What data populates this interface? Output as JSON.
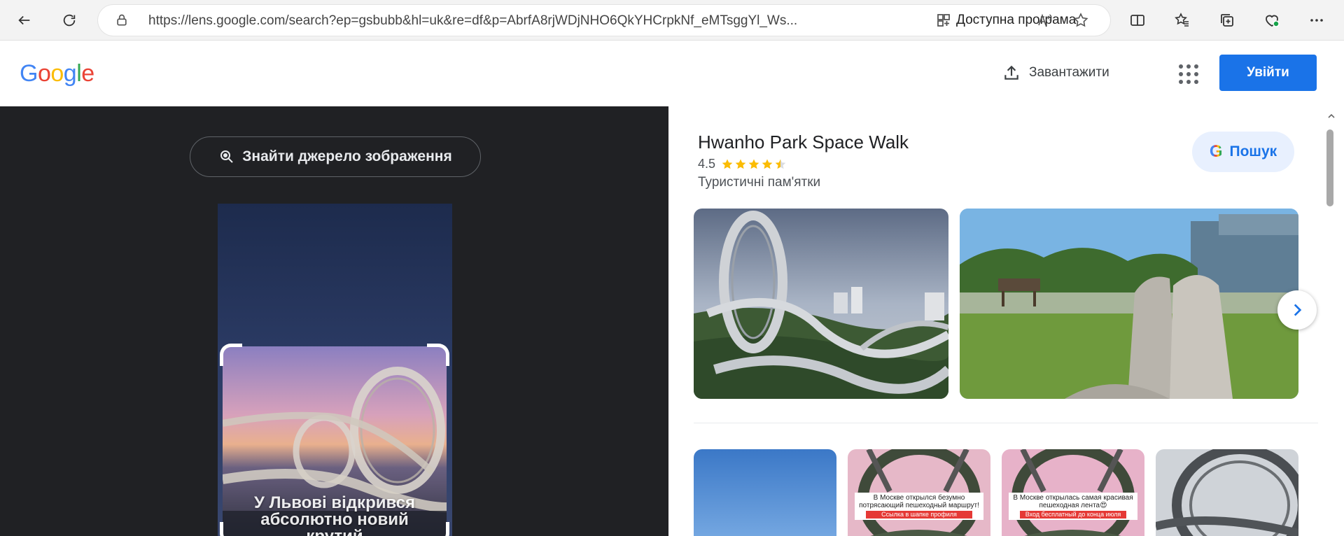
{
  "browser": {
    "url": "https://lens.google.com/search?ep=gsbubb&hl=uk&re=df&p=AbrfA8rjWDjNHO6QkYHCrpkNf_eMTsggYl_Ws...",
    "app_available": "Доступна програма"
  },
  "header": {
    "logo": [
      "G",
      "o",
      "o",
      "g",
      "l",
      "e"
    ],
    "logo_colors": [
      "#4285f4",
      "#ea4335",
      "#fbbc05",
      "#4285f4",
      "#34a853",
      "#ea4335"
    ],
    "upload_label": "Завантажити",
    "signin_label": "Увійти"
  },
  "left": {
    "find_source_label": "Знайти джерело зображення",
    "caption": [
      "У Львові відкрився",
      "абсолютно новий",
      "крутий"
    ]
  },
  "result": {
    "title": "Hwanho Park Space Walk",
    "rating": "4.5",
    "stars": 4.5,
    "category": "Туристичні пам'ятки",
    "search_label": "Пошук",
    "search_g": "G"
  },
  "thumbs": [
    {
      "label": "",
      "red": ""
    },
    {
      "label": "В Москве открылся безумно потрясающий пешеходный маршрут!",
      "red": "Ссылка в шапке профиля"
    },
    {
      "label": "В Москве открылась самая красивая пешеходная лента😍",
      "red": "Вход бесплатный до конца июля"
    },
    {
      "label": "",
      "red": ""
    }
  ],
  "colors": {
    "accent": "#1a73e8",
    "dark_pane": "#202124",
    "star": "#fbbc04"
  }
}
